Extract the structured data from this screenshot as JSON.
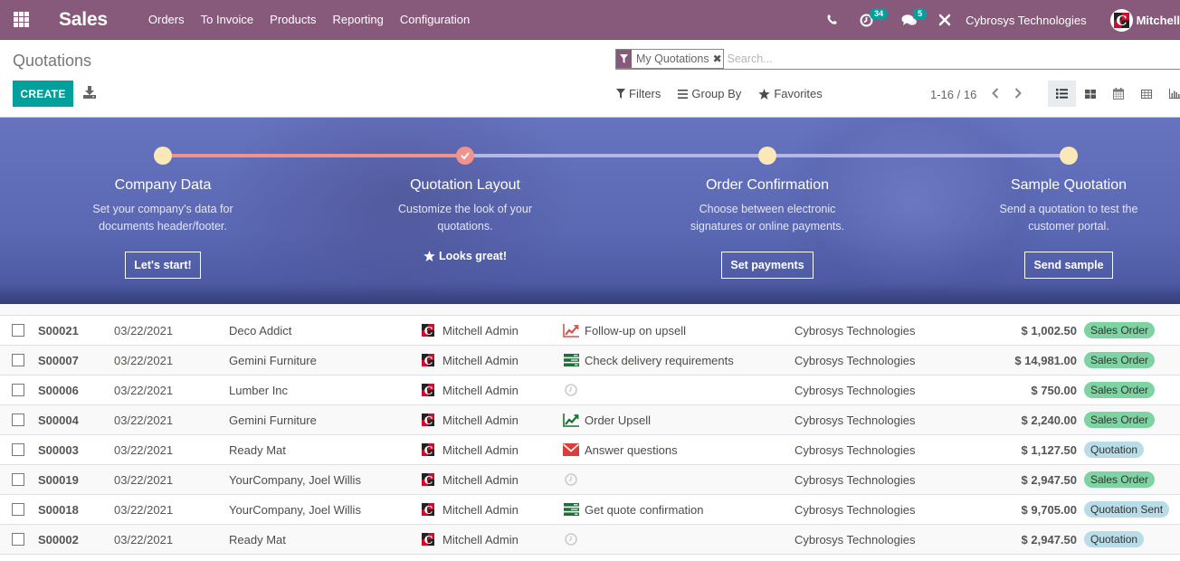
{
  "navbar": {
    "app_name": "Sales",
    "menu": [
      "Orders",
      "To Invoice",
      "Products",
      "Reporting",
      "Configuration"
    ],
    "systray": {
      "activity_count": "34",
      "message_count": "5",
      "company": "Cybrosys Technologies",
      "user": "Mitchell"
    },
    "icons": [
      "apps-grid-icon",
      "phone-icon",
      "activity-clock-icon",
      "chat-icon",
      "debug-tools-icon"
    ]
  },
  "control_panel": {
    "breadcrumb": "Quotations",
    "create_label": "CREATE",
    "search": {
      "facet_label": "My Quotations",
      "placeholder": "Search..."
    },
    "filters_label": "Filters",
    "group_by_label": "Group By",
    "favorites_label": "Favorites",
    "pager": "1-16 / 16",
    "views": [
      "list",
      "kanban",
      "calendar",
      "pivot",
      "graph"
    ],
    "active_view": "list"
  },
  "onboarding": {
    "progress_steps_done": 2,
    "progress_steps_total": 4,
    "steps": [
      {
        "title": "Company Data",
        "desc_line1": "Set your company's data for",
        "desc_line2": "documents header/footer.",
        "button": "Let's start!",
        "state": "todo"
      },
      {
        "title": "Quotation Layout",
        "desc_line1": "Customize the look of your",
        "desc_line2": "quotations.",
        "done_label": "Looks great!",
        "state": "done"
      },
      {
        "title": "Order Confirmation",
        "desc_line1": "Choose between electronic",
        "desc_line2": "signatures or online payments.",
        "button": "Set payments",
        "state": "todo"
      },
      {
        "title": "Sample Quotation",
        "desc_line1": "Send a quotation to test the",
        "desc_line2": "customer portal.",
        "button": "Send sample",
        "state": "todo"
      }
    ]
  },
  "colors": {
    "brand": "#875a7b",
    "primary": "#00a09d",
    "sale_badge": "#7dd3a1",
    "quotation_badge": "#b8dce8",
    "progress_done": "#f0938d",
    "step_dot": "#fbe8b8"
  },
  "rows": [
    {
      "number": "S00021",
      "date": "03/22/2021",
      "customer": "Deco Addict",
      "salesperson": "Mitchell Admin",
      "activity_icon": "upsell-red",
      "activity": "Follow-up on upsell",
      "company": "Cybrosys Technologies",
      "total": "$ 1,002.50",
      "status": "Sales Order",
      "status_kind": "sale"
    },
    {
      "number": "S00007",
      "date": "03/22/2021",
      "customer": "Gemini Furniture",
      "salesperson": "Mitchell Admin",
      "activity_icon": "todo-green",
      "activity": "Check delivery requirements",
      "company": "Cybrosys Technologies",
      "total": "$ 14,981.00",
      "status": "Sales Order",
      "status_kind": "sale"
    },
    {
      "number": "S00006",
      "date": "03/22/2021",
      "customer": "Lumber Inc",
      "salesperson": "Mitchell Admin",
      "activity_icon": "clock-grey",
      "activity": "",
      "company": "Cybrosys Technologies",
      "total": "$ 750.00",
      "status": "Sales Order",
      "status_kind": "sale"
    },
    {
      "number": "S00004",
      "date": "03/22/2021",
      "customer": "Gemini Furniture",
      "salesperson": "Mitchell Admin",
      "activity_icon": "upsell-green",
      "activity": "Order Upsell",
      "company": "Cybrosys Technologies",
      "total": "$ 2,240.00",
      "status": "Sales Order",
      "status_kind": "sale"
    },
    {
      "number": "S00003",
      "date": "03/22/2021",
      "customer": "Ready Mat",
      "salesperson": "Mitchell Admin",
      "activity_icon": "email-red",
      "activity": "Answer questions",
      "company": "Cybrosys Technologies",
      "total": "$ 1,127.50",
      "status": "Quotation",
      "status_kind": "draft"
    },
    {
      "number": "S00019",
      "date": "03/22/2021",
      "customer": "YourCompany, Joel Willis",
      "salesperson": "Mitchell Admin",
      "activity_icon": "clock-grey",
      "activity": "",
      "company": "Cybrosys Technologies",
      "total": "$ 2,947.50",
      "status": "Sales Order",
      "status_kind": "sale"
    },
    {
      "number": "S00018",
      "date": "03/22/2021",
      "customer": "YourCompany, Joel Willis",
      "salesperson": "Mitchell Admin",
      "activity_icon": "todo-green",
      "activity": "Get quote confirmation",
      "company": "Cybrosys Technologies",
      "total": "$ 9,705.00",
      "status": "Quotation Sent",
      "status_kind": "draft"
    },
    {
      "number": "S00002",
      "date": "03/22/2021",
      "customer": "Ready Mat",
      "salesperson": "Mitchell Admin",
      "activity_icon": "clock-grey",
      "activity": "",
      "company": "Cybrosys Technologies",
      "total": "$ 2,947.50",
      "status": "Quotation",
      "status_kind": "draft"
    }
  ]
}
